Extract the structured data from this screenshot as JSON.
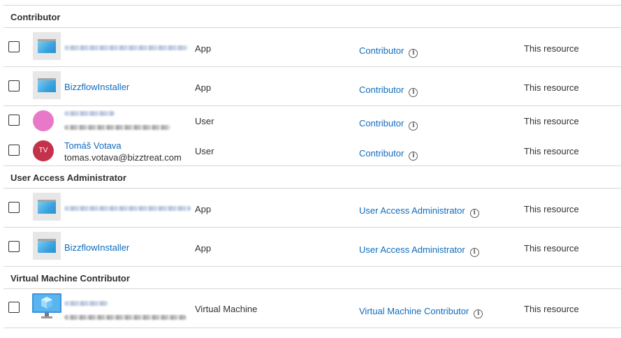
{
  "groups": [
    {
      "title": "Contributor",
      "rows": [
        {
          "name": "",
          "type": "App",
          "role": "Contributor",
          "scope": "This resource"
        },
        {
          "name": "BizzflowInstaller",
          "type": "App",
          "role": "Contributor",
          "scope": "This resource"
        },
        {
          "name": "",
          "type": "User",
          "role": "Contributor",
          "scope": "This resource"
        },
        {
          "name": "Tomáš Votava",
          "email": "tomas.votava@bizztreat.com",
          "avatar_initials": "TV",
          "type": "User",
          "role": "Contributor",
          "scope": "This resource"
        }
      ]
    },
    {
      "title": "User Access Administrator",
      "rows": [
        {
          "name": "",
          "type": "App",
          "role": "User Access Administrator",
          "scope": "This resource"
        },
        {
          "name": "BizzflowInstaller",
          "type": "App",
          "role": "User Access Administrator",
          "scope": "This resource"
        }
      ]
    },
    {
      "title": "Virtual Machine Contributor",
      "rows": [
        {
          "name": "",
          "type": "Virtual Machine",
          "role": "Virtual Machine Contributor",
          "scope": "This resource"
        }
      ]
    }
  ],
  "icons": {
    "info": "info-icon",
    "app": "app-registration-icon",
    "vm": "virtual-machine-icon"
  },
  "colors": {
    "link": "#0f6cbd",
    "avatar_pink": "#e879c9",
    "avatar_tv": "#c4314b",
    "divider": "#d6d6d6"
  }
}
